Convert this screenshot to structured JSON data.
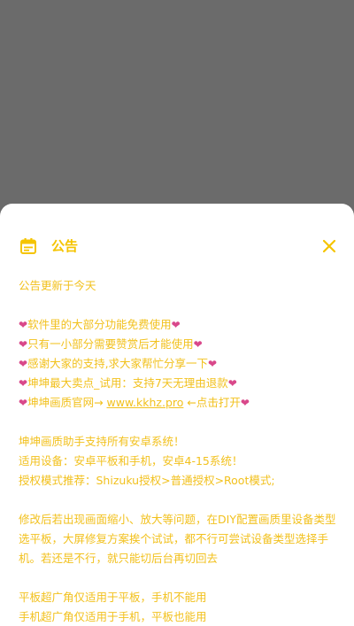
{
  "announcement": {
    "title": "公告",
    "updated": "公告更新于今天",
    "heart_lines": [
      "软件里的大部分功能免费使用",
      "只有一小部分需要赞赏后才能使用",
      "感谢大家的支持,求大家帮忙分享一下",
      "坤坤最大卖点_试用：支持7天无理由退款"
    ],
    "official_site": {
      "prefix": "坤坤画质官网→ ",
      "url": "www.kkhz.pro",
      "suffix": " ←点击打开"
    },
    "support_lines": [
      "坤坤画质助手支持所有安卓系统！",
      "适用设备：安卓平板和手机，安卓4-15系统！",
      "授权模式推荐：Shizuku授权>普通授权>Root模式;"
    ],
    "tip_paragraph": "修改后若出现画面缩小、放大等问题，在DIY配置画质里设备类型选平板，大屏修复方案挨个试试，都不行可尝试设备类型选择手机。若还是不行，就只能切后台再切回去",
    "device_lines": [
      "平板超广角仅适用于平板，手机不能用",
      "手机超广角仅适用于手机，平板也能用"
    ],
    "heart_glyph": "❤"
  },
  "colors": {
    "accent": "#f5c400",
    "text": "#f2c11e",
    "heart": "#d9488a",
    "overlay": "#6b6b6b"
  },
  "icons": {
    "calendar": "calendar-icon",
    "close": "close-icon",
    "heart": "heart-icon"
  }
}
